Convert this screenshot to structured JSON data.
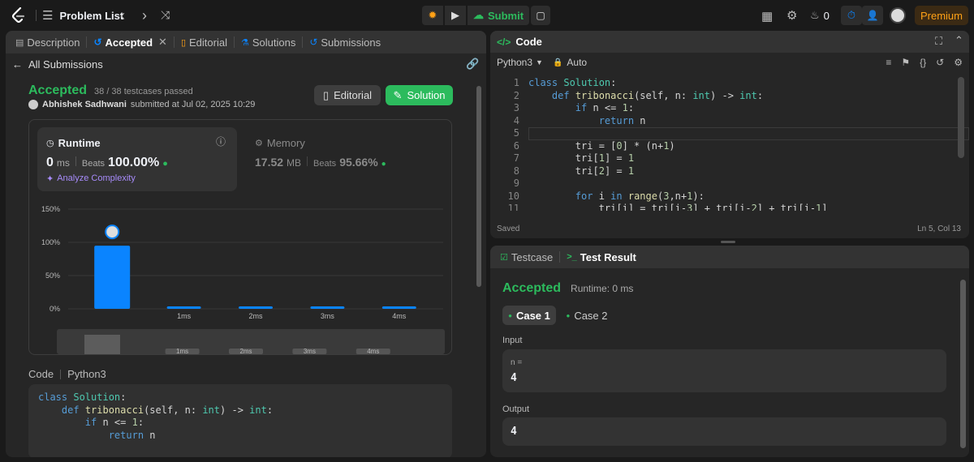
{
  "nav": {
    "problem_list": "Problem List",
    "submit": "Submit",
    "streak": "0",
    "premium": "Premium"
  },
  "left": {
    "tabs": {
      "description": "Description",
      "accepted": "Accepted",
      "editorial": "Editorial",
      "solutions": "Solutions",
      "submissions": "Submissions"
    },
    "back": "All Submissions",
    "status": "Accepted",
    "testcases": "38 / 38 testcases passed",
    "author": "Abhishek Sadhwani",
    "submitted": "submitted at Jul 02, 2025 10:29",
    "editorial_btn": "Editorial",
    "solution_btn": "Solution",
    "runtime": {
      "label": "Runtime",
      "value": "0",
      "unit": "ms",
      "beats_label": "Beats",
      "beats": "100.00%",
      "analyze": "Analyze Complexity"
    },
    "memory": {
      "label": "Memory",
      "value": "17.52",
      "unit": "MB",
      "beats_label": "Beats",
      "beats": "95.66%"
    },
    "code_label": "Code",
    "code_lang": "Python3"
  },
  "chart_data": {
    "type": "bar",
    "categories": [
      "",
      "1ms",
      "2ms",
      "3ms",
      "4ms"
    ],
    "values": [
      95,
      2,
      2,
      2,
      2
    ],
    "yticks": [
      "0%",
      "50%",
      "100%",
      "150%"
    ],
    "ylim": [
      0,
      150
    ],
    "bar_color": "#0a84ff",
    "mini_labels": [
      "1ms",
      "2ms",
      "3ms",
      "4ms"
    ]
  },
  "editor": {
    "title": "Code",
    "lang": "Python3",
    "mode": "Auto",
    "saved": "Saved",
    "cursor": "Ln 5, Col 13"
  },
  "result": {
    "tab_testcase": "Testcase",
    "tab_result": "Test Result",
    "status": "Accepted",
    "runtime": "Runtime: 0 ms",
    "case1": "Case 1",
    "case2": "Case 2",
    "input_label": "Input",
    "input_var": "n =",
    "input_val": "4",
    "output_label": "Output",
    "output_val": "4"
  },
  "colors": {
    "accent_green": "#2cbb5d",
    "accent_blue": "#0a84ff",
    "premium": "#ffa116"
  }
}
